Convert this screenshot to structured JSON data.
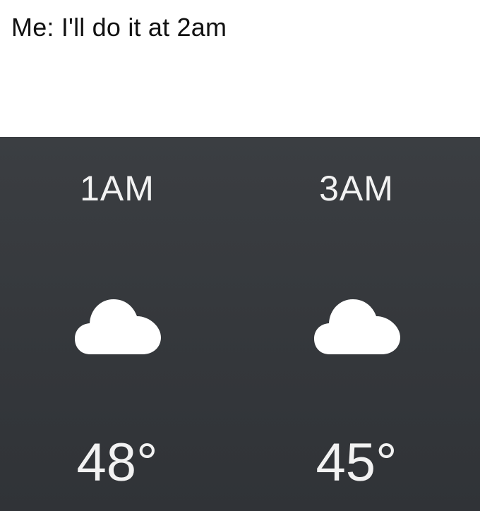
{
  "caption": "Me: I'll do it at 2am",
  "forecast": [
    {
      "time": "1AM",
      "icon": "cloud-icon",
      "temp": "48°"
    },
    {
      "time": "3AM",
      "icon": "cloud-icon",
      "temp": "45°"
    }
  ],
  "colors": {
    "panel_bg": "#36393d",
    "text": "#f2f2f2",
    "cloud": "#ffffff"
  }
}
